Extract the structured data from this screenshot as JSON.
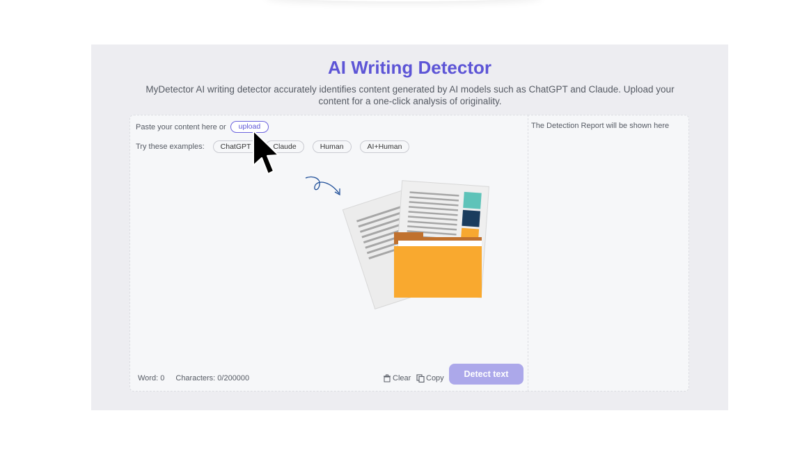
{
  "page": {
    "title": "AI Writing Detector",
    "subtitle": "MyDetector AI writing detector accurately identifies content generated by AI models such as ChatGPT and Claude. Upload your content for a one-click analysis of originality."
  },
  "editor": {
    "paste_label": "Paste your content here or",
    "upload_label": "upload",
    "examples_label": "Try these examples:",
    "examples": [
      "ChatGPT",
      "Claude",
      "Human",
      "AI+Human"
    ],
    "word_count": "Word: 0",
    "char_count": "Characters: 0/200000",
    "clear_label": "Clear",
    "copy_label": "Copy",
    "detect_label": "Detect text"
  },
  "report": {
    "placeholder": "The Detection Report will be shown here"
  },
  "colors": {
    "accent": "#5d55d6",
    "detect_button": "#aca8ea",
    "folder": "#f9a92f"
  },
  "icons": {
    "cursor": "mouse-pointer-icon",
    "arrow": "curl-arrow-icon",
    "folder": "folder-documents-icon",
    "clear": "trash-icon",
    "copy": "copy-icon"
  }
}
